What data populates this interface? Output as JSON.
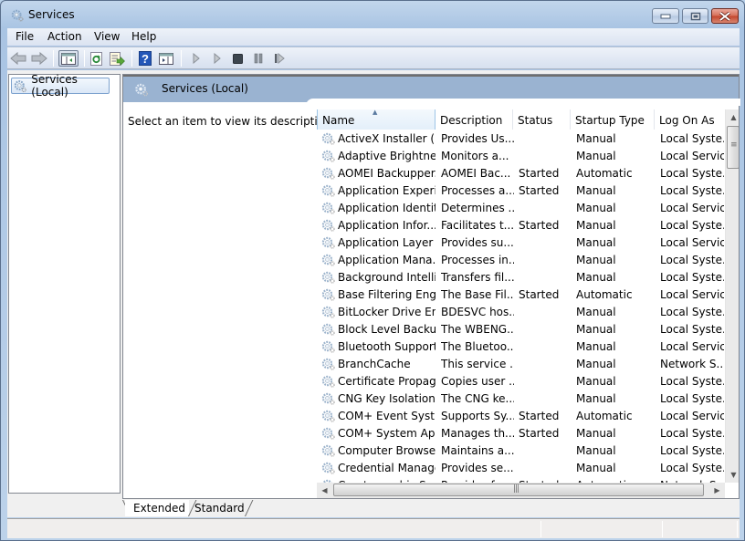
{
  "window": {
    "title": "Services",
    "controls": {
      "minimize": "minimize",
      "maximize": "maximize",
      "close": "close"
    }
  },
  "menu": [
    "File",
    "Action",
    "View",
    "Help"
  ],
  "toolbar": {
    "buttons": [
      {
        "name": "back",
        "icon": "back-arrow-icon"
      },
      {
        "name": "forward",
        "icon": "forward-arrow-icon"
      },
      {
        "name": "show-hide-console-tree",
        "icon": "console-tree-icon",
        "pressed": true
      },
      {
        "name": "refresh",
        "icon": "refresh-icon"
      },
      {
        "name": "export-list",
        "icon": "export-list-icon"
      },
      {
        "name": "help",
        "icon": "help-icon"
      },
      {
        "name": "properties",
        "icon": "properties-pane-icon"
      },
      {
        "name": "start-service",
        "icon": "play-icon"
      },
      {
        "name": "start-service-alt",
        "icon": "play-icon"
      },
      {
        "name": "stop-service",
        "icon": "stop-icon"
      },
      {
        "name": "pause-service",
        "icon": "pause-icon"
      },
      {
        "name": "restart-service",
        "icon": "restart-icon"
      }
    ]
  },
  "tree": {
    "selected": "Services (Local)"
  },
  "pane": {
    "title": "Services (Local)",
    "description_prompt": "Select an item to view its description."
  },
  "list": {
    "columns": [
      "Name",
      "Description",
      "Status",
      "Startup Type",
      "Log On As"
    ],
    "sorted_column": "Name",
    "rows": [
      {
        "name": "ActiveX Installer (...",
        "description": "Provides Us...",
        "status": "",
        "startup": "Manual",
        "logon": "Local Syste..."
      },
      {
        "name": "Adaptive Brightness",
        "description": "Monitors a...",
        "status": "",
        "startup": "Manual",
        "logon": "Local Service"
      },
      {
        "name": "AOMEI Backupper...",
        "description": "AOMEI Bac...",
        "status": "Started",
        "startup": "Automatic",
        "logon": "Local Syste..."
      },
      {
        "name": "Application Experi...",
        "description": "Processes a...",
        "status": "Started",
        "startup": "Manual",
        "logon": "Local Syste..."
      },
      {
        "name": "Application Identity",
        "description": "Determines ...",
        "status": "",
        "startup": "Manual",
        "logon": "Local Service"
      },
      {
        "name": "Application Infor...",
        "description": "Facilitates t...",
        "status": "Started",
        "startup": "Manual",
        "logon": "Local Syste..."
      },
      {
        "name": "Application Layer ...",
        "description": "Provides su...",
        "status": "",
        "startup": "Manual",
        "logon": "Local Service"
      },
      {
        "name": "Application Mana...",
        "description": "Processes in...",
        "status": "",
        "startup": "Manual",
        "logon": "Local Syste..."
      },
      {
        "name": "Background Intelli...",
        "description": "Transfers fil...",
        "status": "",
        "startup": "Manual",
        "logon": "Local Syste..."
      },
      {
        "name": "Base Filtering Engi...",
        "description": "The Base Fil...",
        "status": "Started",
        "startup": "Automatic",
        "logon": "Local Service"
      },
      {
        "name": "BitLocker Drive En...",
        "description": "BDESVC hos...",
        "status": "",
        "startup": "Manual",
        "logon": "Local Syste..."
      },
      {
        "name": "Block Level Backu...",
        "description": "The WBENG...",
        "status": "",
        "startup": "Manual",
        "logon": "Local Syste..."
      },
      {
        "name": "Bluetooth Support...",
        "description": "The Bluetoo...",
        "status": "",
        "startup": "Manual",
        "logon": "Local Service"
      },
      {
        "name": "BranchCache",
        "description": "This service ...",
        "status": "",
        "startup": "Manual",
        "logon": "Network S..."
      },
      {
        "name": "Certificate Propag...",
        "description": "Copies user ...",
        "status": "",
        "startup": "Manual",
        "logon": "Local Syste..."
      },
      {
        "name": "CNG Key Isolation",
        "description": "The CNG ke...",
        "status": "",
        "startup": "Manual",
        "logon": "Local Syste..."
      },
      {
        "name": "COM+ Event Syst...",
        "description": "Supports Sy...",
        "status": "Started",
        "startup": "Automatic",
        "logon": "Local Service"
      },
      {
        "name": "COM+ System Ap...",
        "description": "Manages th...",
        "status": "Started",
        "startup": "Manual",
        "logon": "Local Syste..."
      },
      {
        "name": "Computer Browser",
        "description": "Maintains a...",
        "status": "",
        "startup": "Manual",
        "logon": "Local Syste..."
      },
      {
        "name": "Credential Manager",
        "description": "Provides se...",
        "status": "",
        "startup": "Manual",
        "logon": "Local Syste..."
      },
      {
        "name": "Cryptographic Ser...",
        "description": "Provides fo...",
        "status": "Started",
        "startup": "Automatic",
        "logon": "Network S..."
      }
    ]
  },
  "view_tabs": [
    "Extended",
    "Standard"
  ],
  "active_view_tab": "Extended",
  "colors": {
    "pane_header": "#9ab3d1",
    "window_frame": "#b9d1ea",
    "close_button": "#c3452c"
  }
}
